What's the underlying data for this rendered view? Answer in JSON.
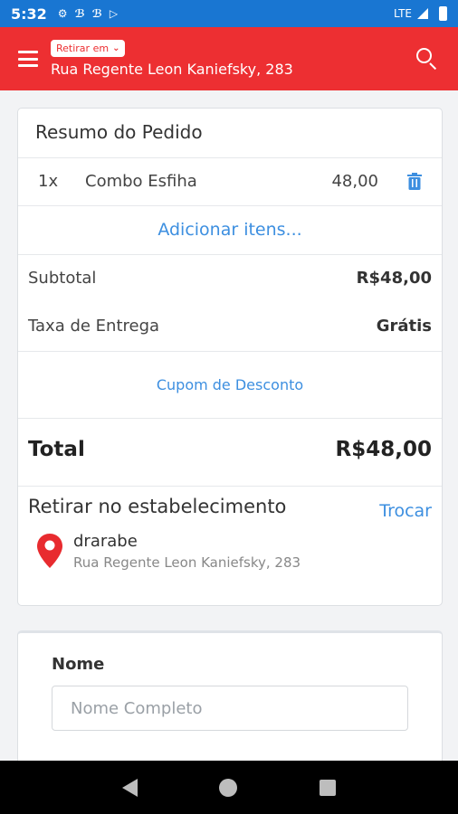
{
  "status_bar": {
    "time": "5:32",
    "icons": [
      "gear-icon",
      "bb-icon",
      "bb-icon",
      "play-icon"
    ],
    "network": "LTE"
  },
  "header": {
    "pickup_chip": "Retirar em",
    "address": "Rua Regente Leon Kaniefsky, 283",
    "color": "#ed2f32"
  },
  "summary": {
    "title": "Resumo do Pedido",
    "items": [
      {
        "qty": "1x",
        "name": "Combo Esfiha",
        "price": "48,00"
      }
    ],
    "add_items": "Adicionar itens...",
    "subtotal_label": "Subtotal",
    "subtotal_value": "R$48,00",
    "delivery_label": "Taxa de Entrega",
    "delivery_value": "Grátis",
    "coupon": "Cupom de Desconto",
    "total_label": "Total",
    "total_value": "R$48,00",
    "pickup_title": "Retirar no estabelecimento",
    "swap": "Trocar",
    "store_name": "drarabe",
    "store_address": "Rua Regente Leon Kaniefsky, 283"
  },
  "form": {
    "name_label": "Nome",
    "name_placeholder": "Nome Completo",
    "name_value": ""
  },
  "colors": {
    "status_bar": "#1976d2",
    "accent_blue": "#3d8fe0",
    "brand_red": "#ed2f32"
  }
}
